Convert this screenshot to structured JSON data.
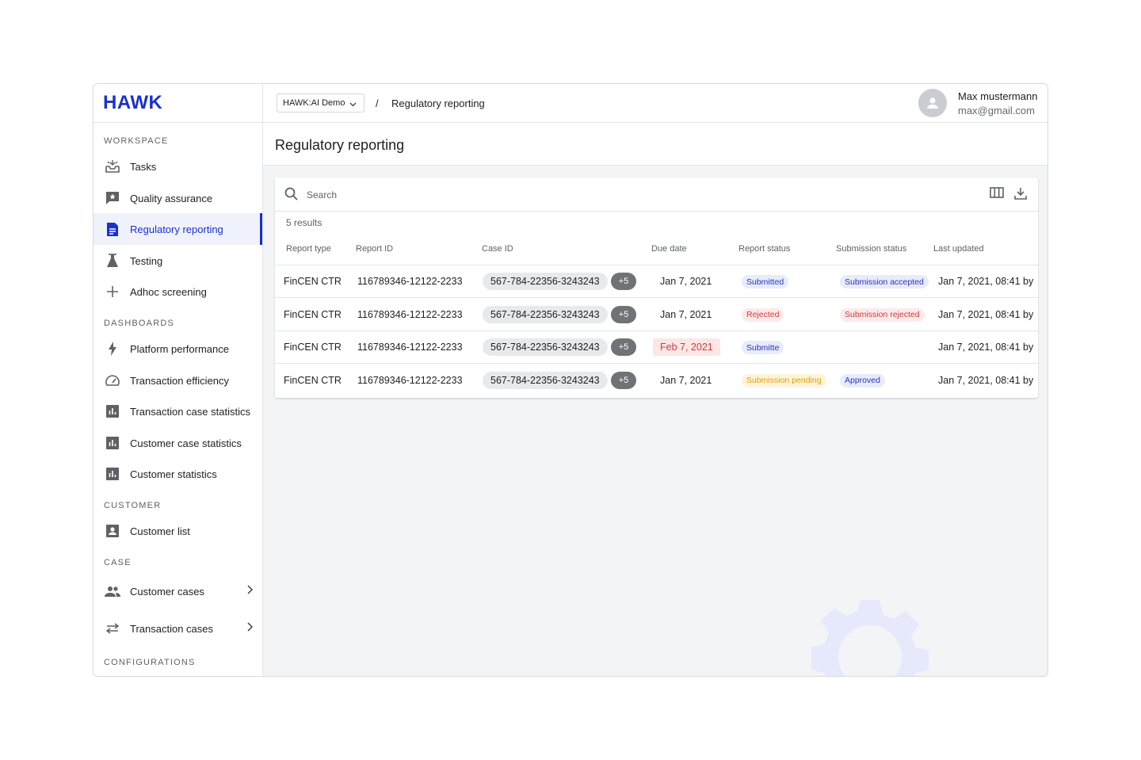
{
  "logo": "HAWK",
  "sidebar": {
    "sections": [
      "WORKSPACE",
      "DASHBOARDS",
      "CUSTOMER",
      "CASE",
      "CONFIGURATIONS"
    ],
    "items": [
      {
        "label": "Tasks",
        "icon": "inbox-icon"
      },
      {
        "label": "Quality assurance",
        "icon": "quality-icon"
      },
      {
        "label": "Regulatory reporting",
        "icon": "document-icon",
        "active": true
      },
      {
        "label": "Testing",
        "icon": "flask-icon"
      },
      {
        "label": "Adhoc screening",
        "icon": "plus-icon"
      },
      {
        "label": "Platform performance",
        "icon": "bolt-icon"
      },
      {
        "label": "Transaction efficiency",
        "icon": "speedometer-icon"
      },
      {
        "label": "Transaction case statistics",
        "icon": "bar-chart-icon"
      },
      {
        "label": "Customer case statistics",
        "icon": "bar-chart-icon"
      },
      {
        "label": "Customer statistics",
        "icon": "bar-chart-icon"
      },
      {
        "label": "Customer list",
        "icon": "person-box-icon"
      },
      {
        "label": "Customer cases",
        "icon": "people-icon"
      },
      {
        "label": "Transaction cases",
        "icon": "swap-icon"
      }
    ]
  },
  "topbar": {
    "org": "HAWK:AI Demo",
    "separator": "/",
    "breadcrumb": "Regulatory reporting",
    "user_name": "Max mustermann",
    "user_email": "max@gmail.com"
  },
  "page": {
    "title": "Regulatory reporting",
    "search_placeholder": "Search",
    "results": "5 results"
  },
  "table": {
    "columns": [
      "Report type",
      "Report ID",
      "Case ID",
      "Due date",
      "Report status",
      "Submission status",
      "Last updated"
    ],
    "rows": [
      {
        "type": "FinCEN CTR",
        "report_id": "116789346-12122-2233",
        "case_id": "567-784-22356-3243243",
        "more": "+5",
        "due": "Jan 7, 2021",
        "due_overdue": false,
        "report_status": "Submitted",
        "report_status_kind": "blue",
        "submission_status": "Submission accepted",
        "submission_kind": "blue",
        "updated": "Jan 7, 2021, 08:41 by"
      },
      {
        "type": "FinCEN CTR",
        "report_id": "116789346-12122-2233",
        "case_id": "567-784-22356-3243243",
        "more": "+5",
        "due": "Jan 7, 2021",
        "due_overdue": false,
        "report_status": "Rejected",
        "report_status_kind": "red",
        "submission_status": "Submission rejected",
        "submission_kind": "red",
        "updated": "Jan 7, 2021, 08:41 by"
      },
      {
        "type": "FinCEN CTR",
        "report_id": "116789346-12122-2233",
        "case_id": "567-784-22356-3243243",
        "more": "+5",
        "due": "Feb 7, 2021",
        "due_overdue": true,
        "report_status": "Submitte",
        "report_status_kind": "blue",
        "submission_status": "",
        "submission_kind": "none",
        "updated": "Jan 7, 2021, 08:41 by"
      },
      {
        "type": "FinCEN CTR",
        "report_id": "116789346-12122-2233",
        "case_id": "567-784-22356-3243243",
        "more": "+5",
        "due": "Jan 7, 2021",
        "due_overdue": false,
        "report_status": "Submission pending",
        "report_status_kind": "yellow",
        "submission_status": "Approved",
        "submission_kind": "blue",
        "updated": "Jan 7, 2021, 08:41 by"
      }
    ]
  },
  "colors": {
    "brand": "#1a2fd1",
    "badge_blue_bg": "#e8ebfb",
    "badge_blue_fg": "#2634b8",
    "badge_red_bg": "#fdeaea",
    "badge_red_fg": "#d23a3a",
    "badge_yellow_bg": "#fdf4dc",
    "badge_yellow_fg": "#e0a100",
    "overdue_bg": "#fde6e6",
    "overdue_fg": "#d23a3a"
  }
}
